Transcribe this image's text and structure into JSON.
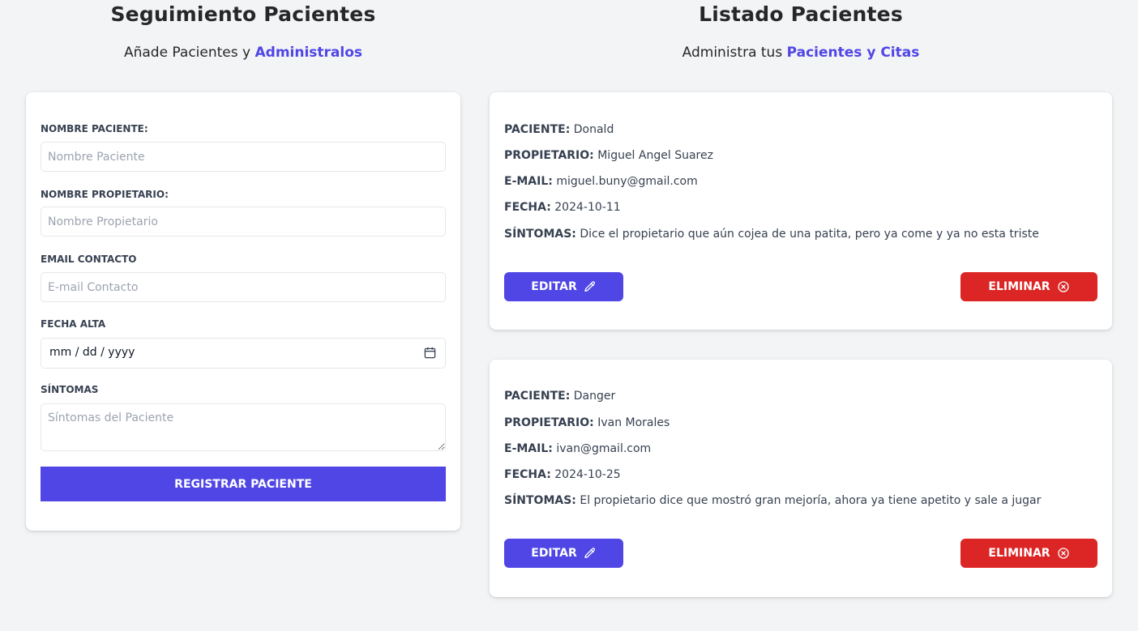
{
  "left": {
    "title": "Seguimiento Pacientes",
    "subtitle_prefix": "Añade Pacientes y",
    "subtitle_accent": "Administralos"
  },
  "right": {
    "title": "Listado Pacientes",
    "subtitle_prefix": "Administra tus",
    "subtitle_accent": "Pacientes y Citas"
  },
  "form": {
    "fields": [
      {
        "label": "Nombre Paciente:",
        "placeholder": "Nombre Paciente",
        "value": ""
      },
      {
        "label": "Nombre Propietario:",
        "placeholder": "Nombre Propietario",
        "value": ""
      },
      {
        "label": "Email Contacto",
        "placeholder": "E-mail Contacto",
        "value": ""
      },
      {
        "label": "Fecha Alta",
        "placeholder": "mm / dd / yyyy",
        "value": ""
      },
      {
        "label": "Síntomas",
        "placeholder": "Síntomas del Paciente",
        "value": ""
      }
    ],
    "submit_label": "Registrar Paciente"
  },
  "patients": [
    {
      "keys": {
        "paciente": "Paciente:",
        "propietario": "Propietario:",
        "email": "E-mail:",
        "fecha": "Fecha:",
        "sintomas": "Síntomas:"
      },
      "paciente": "Donald",
      "propietario": "Miguel Angel Suarez",
      "email": "miguel.buny@gmail.com",
      "fecha": "2024-10-11",
      "sintomas": "Dice el propietario que aún cojea de una patita, pero ya come y ya no esta triste",
      "edit_label": "Editar",
      "delete_label": "Eliminar"
    },
    {
      "keys": {
        "paciente": "Paciente:",
        "propietario": "Propietario:",
        "email": "E-mail:",
        "fecha": "Fecha:",
        "sintomas": "Síntomas:"
      },
      "paciente": "Danger",
      "propietario": "Ivan Morales",
      "email": "ivan@gmail.com",
      "fecha": "2024-10-25",
      "sintomas": "El propietario dice que mostró gran mejoría, ahora ya tiene apetito y sale a jugar",
      "edit_label": "Editar",
      "delete_label": "Eliminar"
    }
  ],
  "icons": {
    "edit": "pencil-icon",
    "delete": "x-circle-icon",
    "date": "calendar-icon"
  },
  "colors": {
    "accent": "#4f46e5",
    "danger": "#dc2626",
    "background": "#f3f4f6"
  }
}
